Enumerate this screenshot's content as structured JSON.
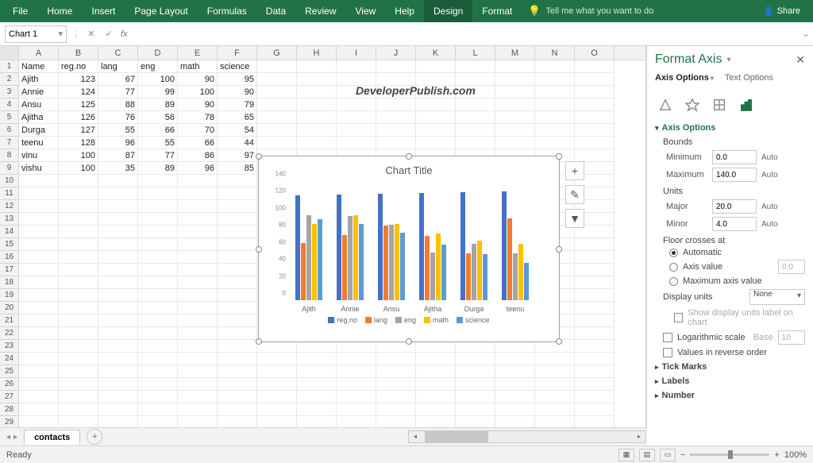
{
  "ribbon": {
    "tabs": [
      "File",
      "Home",
      "Insert",
      "Page Layout",
      "Formulas",
      "Data",
      "Review",
      "View",
      "Help",
      "Design",
      "Format"
    ],
    "active_index": 9,
    "tell_me": "Tell me what you want to do",
    "share": "Share"
  },
  "namebox": "Chart 1",
  "watermark": "DeveloperPublish.com",
  "columns": [
    "A",
    "B",
    "C",
    "D",
    "E",
    "F",
    "G",
    "H",
    "I",
    "J",
    "K",
    "L",
    "M",
    "N",
    "O"
  ],
  "row_count": 30,
  "table": {
    "headers": [
      "Name",
      "reg.no",
      "lang",
      "eng",
      "math",
      "science"
    ],
    "rows": [
      [
        "Ajith",
        123,
        67,
        100,
        90,
        95
      ],
      [
        "Annie",
        124,
        77,
        99,
        100,
        90
      ],
      [
        "Ansu",
        125,
        88,
        89,
        90,
        79
      ],
      [
        "Ajitha",
        126,
        76,
        56,
        78,
        65
      ],
      [
        "Durga",
        127,
        55,
        66,
        70,
        54
      ],
      [
        "teenu",
        128,
        96,
        55,
        66,
        44
      ],
      [
        "vinu",
        100,
        87,
        77,
        86,
        97
      ],
      [
        "vishu",
        100,
        35,
        89,
        96,
        85
      ]
    ]
  },
  "chart_data": {
    "type": "bar",
    "title": "Chart Title",
    "categories": [
      "Ajith",
      "Annie",
      "Ansu",
      "Ajitha",
      "Durga",
      "teenu"
    ],
    "series": [
      {
        "name": "reg.no",
        "color": "#4472c4",
        "values": [
          123,
          124,
          125,
          126,
          127,
          128
        ]
      },
      {
        "name": "lang",
        "color": "#ed7d31",
        "values": [
          67,
          77,
          88,
          76,
          55,
          96
        ]
      },
      {
        "name": "eng",
        "color": "#a5a5a5",
        "values": [
          100,
          99,
          89,
          56,
          66,
          55
        ]
      },
      {
        "name": "math",
        "color": "#ffc000",
        "values": [
          90,
          100,
          90,
          78,
          70,
          66
        ]
      },
      {
        "name": "science",
        "color": "#5b9bd5",
        "values": [
          95,
          90,
          79,
          65,
          54,
          44
        ]
      }
    ],
    "ylim": [
      0,
      140
    ],
    "yticks": [
      0,
      20,
      40,
      60,
      80,
      100,
      120,
      140
    ],
    "legend_pos": "bottom"
  },
  "chart_side": {
    "plus": "+",
    "brush": "✎",
    "filter": "▼"
  },
  "pane": {
    "title": "Format Axis",
    "tabs": [
      "Axis Options",
      "Text Options"
    ],
    "section_axis": "Axis Options",
    "bounds_h": "Bounds",
    "min_l": "Minimum",
    "min_v": "0.0",
    "max_l": "Maximum",
    "max_v": "140.0",
    "auto": "Auto",
    "units_h": "Units",
    "major_l": "Major",
    "major_v": "20.0",
    "minor_l": "Minor",
    "minor_v": "4.0",
    "floor_h": "Floor crosses at",
    "floor_auto": "Automatic",
    "floor_val": "Axis value",
    "floor_val_v": "0.0",
    "floor_max": "Maximum axis value",
    "display_units": "Display units",
    "display_units_v": "None",
    "show_units": "Show display units label on chart",
    "log": "Logarithmic scale",
    "base_l": "Base",
    "base_v": "10",
    "reverse": "Values in reverse order",
    "tick_marks": "Tick Marks",
    "labels": "Labels",
    "number": "Number"
  },
  "sheet_tab": "contacts",
  "status": {
    "ready": "Ready",
    "zoom": "100%"
  }
}
